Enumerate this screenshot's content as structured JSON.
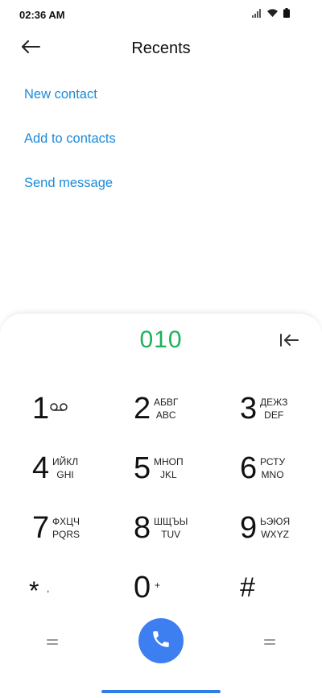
{
  "status_bar": {
    "time": "02:36 AM"
  },
  "header": {
    "title": "Recents"
  },
  "actions": {
    "new_contact": "New contact",
    "add_to_contacts": "Add to contacts",
    "send_message": "Send message"
  },
  "dialer": {
    "number": "010",
    "keys": [
      {
        "digit": "1",
        "letters_top": "",
        "letters_bottom": "",
        "icon": "voicemail-icon"
      },
      {
        "digit": "2",
        "letters_top": "АБВГ",
        "letters_bottom": "ABC"
      },
      {
        "digit": "3",
        "letters_top": "ДЕЖЗ",
        "letters_bottom": "DEF"
      },
      {
        "digit": "4",
        "letters_top": "ИЙКЛ",
        "letters_bottom": "GHI"
      },
      {
        "digit": "5",
        "letters_top": "МНОП",
        "letters_bottom": "JKL"
      },
      {
        "digit": "6",
        "letters_top": "РСТУ",
        "letters_bottom": "MNO"
      },
      {
        "digit": "7",
        "letters_top": "ФХЦЧ",
        "letters_bottom": "PQRS"
      },
      {
        "digit": "8",
        "letters_top": "ШЩЪЫ",
        "letters_bottom": "TUV"
      },
      {
        "digit": "9",
        "letters_top": "ЬЭЮЯ",
        "letters_bottom": "WXYZ"
      },
      {
        "digit": "*",
        "letters_top": "",
        "letters_bottom": "",
        "symbol": ","
      },
      {
        "digit": "0",
        "letters_top": "",
        "letters_bottom": "",
        "symbol": "+"
      },
      {
        "digit": "#",
        "letters_top": "",
        "letters_bottom": ""
      }
    ]
  },
  "colors": {
    "accent_link": "#1d8ad8",
    "number_green": "#1db15b",
    "call_blue": "#3d7ff0"
  }
}
